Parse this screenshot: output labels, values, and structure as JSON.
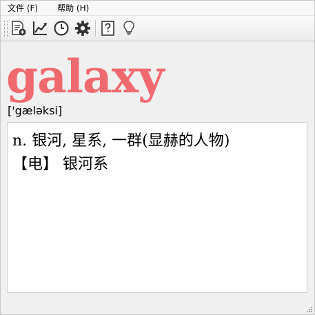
{
  "menu": {
    "items": [
      {
        "label": "文件 (F)"
      },
      {
        "label": "帮助 (H)"
      }
    ]
  },
  "toolbar": {
    "buttons": [
      {
        "icon": "add-document-icon"
      },
      {
        "icon": "chart-icon"
      },
      {
        "icon": "history-clock-icon"
      },
      {
        "icon": "settings-gear-icon"
      },
      {
        "icon": "help-question-icon"
      },
      {
        "icon": "lightbulb-icon"
      }
    ]
  },
  "entry": {
    "headword": "galaxy",
    "phonetic": "['gæləksi]",
    "definitions": [
      "n. 银河, 星系, 一群(显赫的人物)",
      "【电】 银河系"
    ]
  },
  "colors": {
    "headword": "#ef6a6f"
  }
}
